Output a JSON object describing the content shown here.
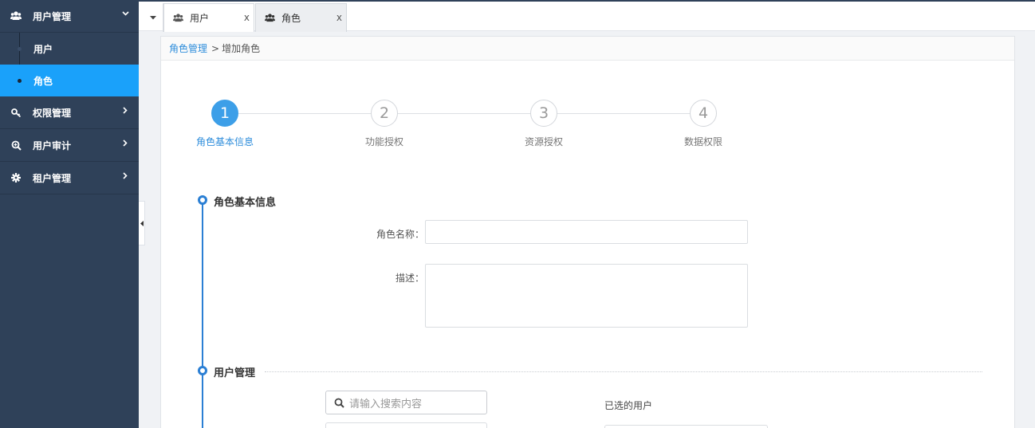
{
  "sidebar": {
    "groups": [
      {
        "label": "用户管理",
        "icon": "users-icon",
        "expanded": true
      },
      {
        "label": "权限管理",
        "icon": "key-icon"
      },
      {
        "label": "用户审计",
        "icon": "search-zoom-icon"
      },
      {
        "label": "租户管理",
        "icon": "gear-icon"
      }
    ],
    "sub_items": [
      {
        "label": "用户"
      },
      {
        "label": "角色",
        "active": true
      }
    ]
  },
  "tabs": [
    {
      "label": "用户",
      "close": "x"
    },
    {
      "label": "角色",
      "close": "x"
    }
  ],
  "breadcrumb": {
    "parent": "角色管理",
    "separator": ">",
    "current": "增加角色"
  },
  "steps": [
    {
      "number": "1",
      "label": "角色基本信息"
    },
    {
      "number": "2",
      "label": "功能授权"
    },
    {
      "number": "3",
      "label": "资源授权"
    },
    {
      "number": "4",
      "label": "数据权限"
    }
  ],
  "basic_section": {
    "title": "角色基本信息",
    "name_label": "角色名称：",
    "name_value": "",
    "desc_label": "描述：",
    "desc_value": ""
  },
  "user_section": {
    "title": "用户管理",
    "search_placeholder": "请输入搜索内容",
    "selected_label": "已选的用户"
  },
  "colors": {
    "sidebar_bg": "#2f4159",
    "active_item": "#1aa1fa",
    "accent": "#3d9fe8",
    "timeline": "#2b7fd4"
  }
}
